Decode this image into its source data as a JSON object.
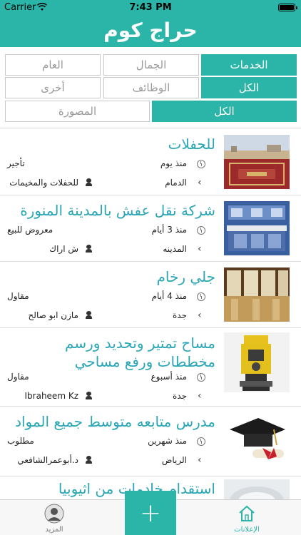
{
  "status_bar": {
    "carrier": "Carrier",
    "time": "7:43 PM"
  },
  "header": {
    "title": "حراج كوم"
  },
  "filters": {
    "row1": [
      "الخدمات",
      "الجمال",
      "العام"
    ],
    "row2": [
      "الكل",
      "الوظائف",
      "أخرى"
    ],
    "row3": [
      "الكل",
      "المصورة"
    ]
  },
  "listings": [
    {
      "title": "للحفلات",
      "time": "منذ يوم",
      "type": "تأجير",
      "city": "الدمام",
      "user": "للحفلات والمخيمات",
      "thumb_icon": "carpet-photo"
    },
    {
      "title": "شركة نقل عفش بالمدينة المنورة",
      "time": "منذ 3 أيام",
      "type": "معروض للبيع",
      "city": "المدينه",
      "user": "ش اراك",
      "thumb_icon": "kitchen-photo"
    },
    {
      "title": "جلي رخام",
      "time": "منذ 4 أيام",
      "type": "مقاول",
      "city": "جدة",
      "user": "مازن ابو صالح",
      "thumb_icon": "marble-floor-photo"
    },
    {
      "title": "مساح تمتير وتحديد ورسم مخططات ورفع مساحي",
      "time": "منذ أسبوع",
      "type": "مقاول",
      "city": "جدة",
      "user": "Ibraheem Kz",
      "thumb_icon": "survey-instrument-photo"
    },
    {
      "title": "مدرس متابعه متوسط جميع المواد",
      "time": "منذ شهرين",
      "type": "مطلوب",
      "city": "الرياض",
      "user": "د.أبوعمرالشافعي",
      "thumb_icon": "graduation-cap-photo"
    },
    {
      "title": "استقدام خادمات من اثيوبيا",
      "thumb_icon": "fabric-photo"
    }
  ],
  "tab_bar": {
    "home_label": "الإعلانات",
    "more_label": "المزيد",
    "add_label": "+"
  },
  "colors": {
    "accent": "#2bb5a8",
    "title_link": "#2aa6b6"
  }
}
